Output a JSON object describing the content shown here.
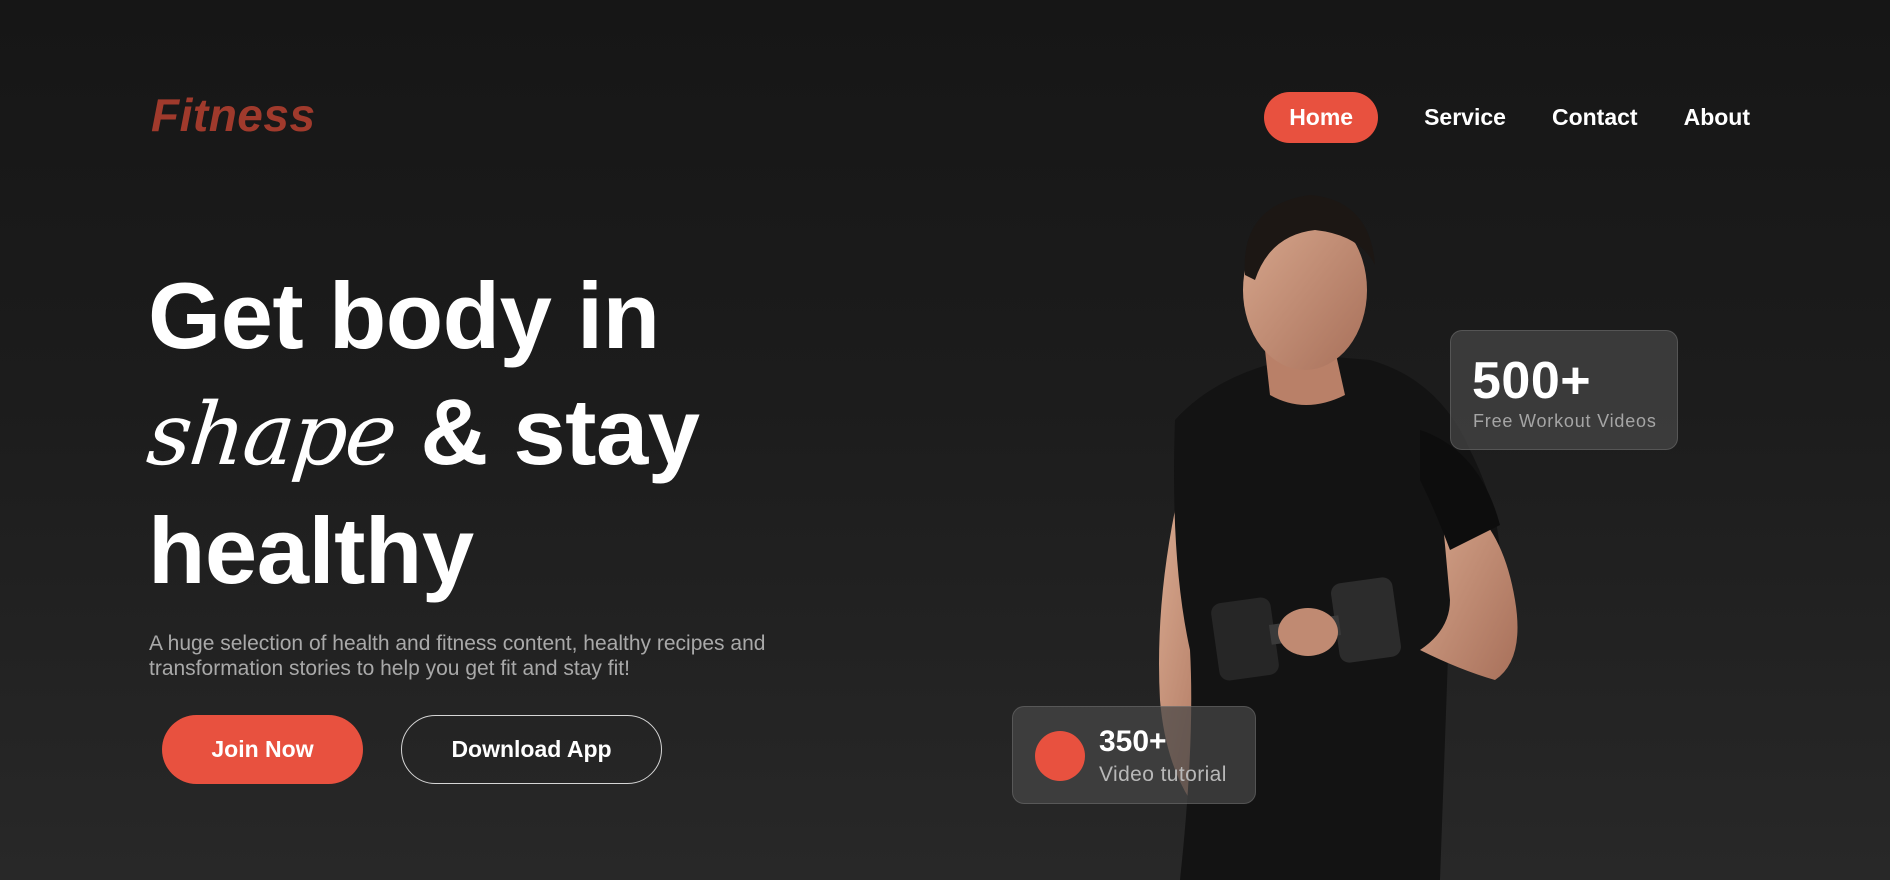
{
  "brand": {
    "logo_text": "Fitness",
    "accent_color": "#e8513f",
    "logo_color": "#a03a2c"
  },
  "nav": {
    "items": [
      {
        "label": "Home",
        "active": true
      },
      {
        "label": "Service",
        "active": false
      },
      {
        "label": "Contact",
        "active": false
      },
      {
        "label": "About",
        "active": false
      }
    ]
  },
  "hero": {
    "headline_line1": "Get body in",
    "headline_script": "shape",
    "headline_line2_rest": "& stay",
    "headline_line3": "healthy",
    "subtitle": "A huge selection of health and fitness content, healthy recipes and transformation stories to help you get fit and stay fit!",
    "primary_button": "Join Now",
    "secondary_button": "Download App",
    "image_subject": "man-lifting-dumbbell"
  },
  "stats": {
    "videos": {
      "value": "500+",
      "label": "Free Workout Videos"
    },
    "tutorials": {
      "value": "350+",
      "label": "Video tutorial"
    }
  }
}
